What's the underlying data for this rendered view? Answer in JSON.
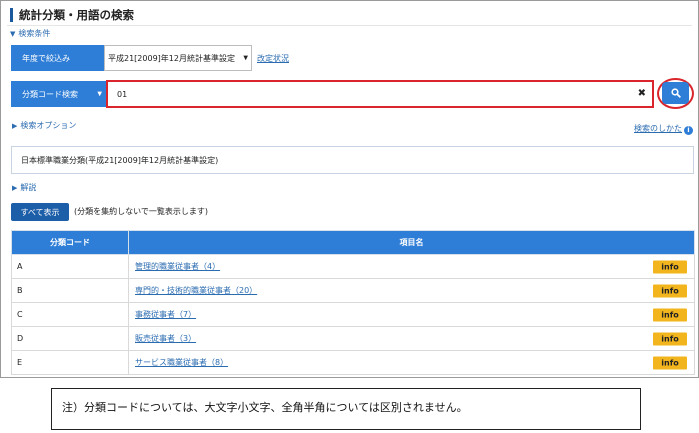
{
  "page": {
    "title": "統計分類・用語の検索",
    "search_conditions_toggle": "検索条件"
  },
  "narrow_by_year": {
    "label": "年度で絞込み",
    "selected_value": "平成21[2009]年12月統計基準設定",
    "revision_link": "改定状況"
  },
  "search": {
    "mode_label": "分類コード検索",
    "input_value": "01",
    "clear_icon": "close-icon",
    "button_icon": "search-icon"
  },
  "options": {
    "search_options_toggle": "検索オプション",
    "how_to_search_link": "検索のしかた",
    "info_icon": "i"
  },
  "classification": {
    "name": "日本標準職業分類(平成21[2009]年12月統計基準設定)"
  },
  "explanation_toggle": "解説",
  "show_all": {
    "button_label": "すべて表示",
    "note": "(分類を集約しないで一覧表示します)"
  },
  "table": {
    "headers": [
      "分類コード",
      "項目名"
    ],
    "rows": [
      {
        "code": "A",
        "name": "管理的職業従事者（4）",
        "badge": "info"
      },
      {
        "code": "B",
        "name": "専門的・技術的職業従事者（20）",
        "badge": "info"
      },
      {
        "code": "C",
        "name": "事務従事者（7）",
        "badge": "info"
      },
      {
        "code": "D",
        "name": "販売従事者（3）",
        "badge": "info"
      },
      {
        "code": "E",
        "name": "サービス職業従事者（8）",
        "badge": "info"
      }
    ]
  },
  "footnote": "注）分類コードについては、大文字小文字、全角半角については区別されません。",
  "colors": {
    "accent_blue": "#2e7dd6",
    "highlight_red": "#d9252b",
    "info_badge": "#f2b51d"
  }
}
